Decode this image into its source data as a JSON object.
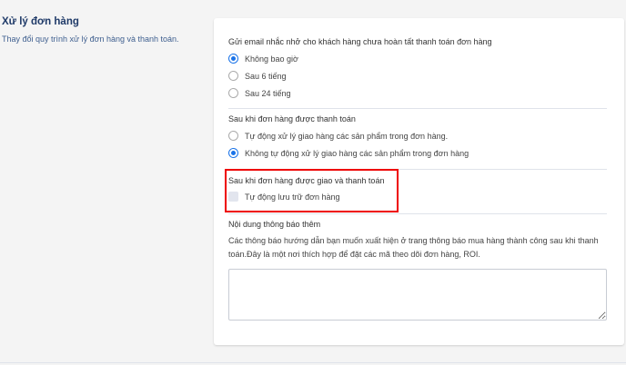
{
  "section": {
    "title": "Xử lý đơn hàng",
    "description": "Thay đổi quy trình xử lý đơn hàng và thanh toán."
  },
  "email_reminder": {
    "label": "Gửi email nhắc nhở cho khách hàng chưa hoàn tất thanh toán đơn hàng",
    "options": [
      "Không bao giờ",
      "Sau 6 tiếng",
      "Sau 24 tiếng"
    ],
    "selected": "Không bao giờ"
  },
  "after_paid": {
    "label": "Sau khi đơn hàng được thanh toán",
    "options": [
      "Tự động xử lý giao hàng các sản phẩm trong đơn hàng.",
      "Không tự động xử lý giao hàng các sản phẩm trong đơn hàng"
    ],
    "selected": "Không tự động xử lý giao hàng các sản phẩm trong đơn hàng"
  },
  "after_delivered": {
    "label": "Sau khi đơn hàng được giao và thanh toán",
    "checkbox_label": "Tự động lưu trữ đơn hàng",
    "checked": false
  },
  "extra_notice": {
    "label": "Nội dung thông báo thêm",
    "description": "Các thông báo hướng dẫn bạn muốn xuất hiện ở trang thông báo mua hàng thành công sau khi thanh toán.Đây là một nơi thích hợp để đặt các mã theo dõi đơn hàng, ROI.",
    "value": ""
  },
  "colors": {
    "accent": "#1a73e8",
    "highlight": "#ee0000"
  }
}
